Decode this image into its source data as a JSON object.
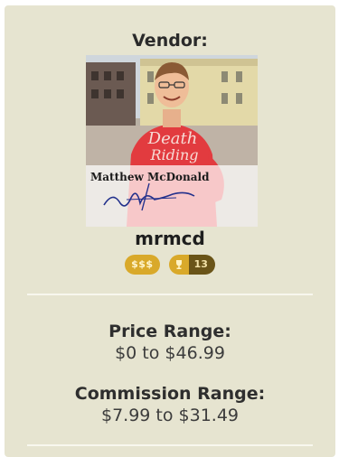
{
  "vendor": {
    "label": "Vendor:",
    "username": "mrmcd",
    "photo_alt": "Matthew McDonald",
    "signature_name": "Matthew McDonald",
    "shirt_text_1": "Death",
    "shirt_text_2": "Riding"
  },
  "badges": {
    "price_level": "$$$",
    "trophy_count": "13"
  },
  "price_range": {
    "title": "Price Range:",
    "value": "$0 to $46.99"
  },
  "commission_range": {
    "title": "Commission Range:",
    "value": "$7.99 to $31.49"
  },
  "colors": {
    "card_bg": "#e6e4d0",
    "badge_gold": "#d9a92a",
    "badge_dark": "#6a5418"
  }
}
